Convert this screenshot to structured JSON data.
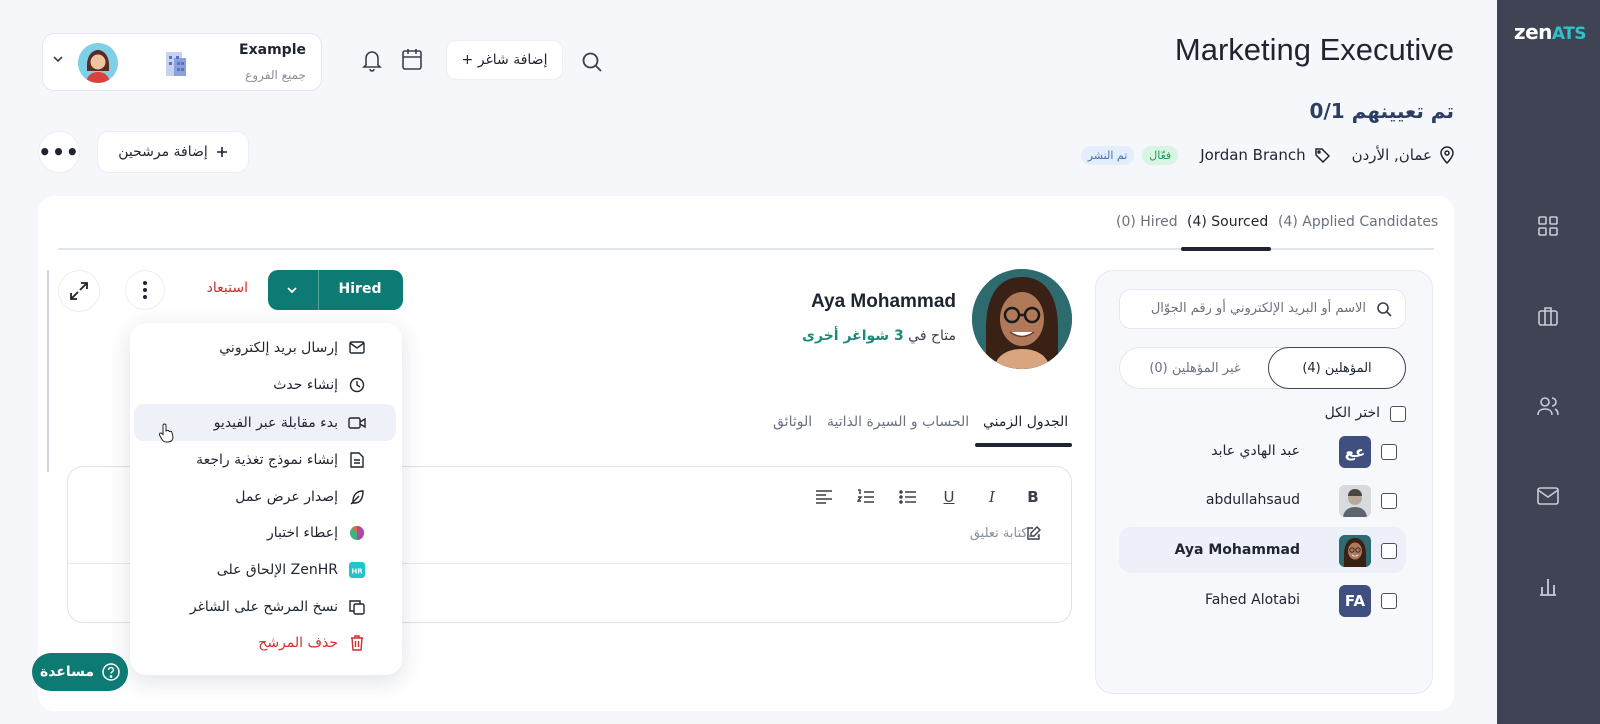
{
  "app": {
    "logo_main": "zen",
    "logo_accent": "ATS"
  },
  "sidebar": {
    "items": [
      "dashboard-icon",
      "jobs-icon",
      "candidates-icon",
      "messages-icon",
      "reports-icon"
    ]
  },
  "header": {
    "org_name": "Example",
    "org_subtitle": "جميع الفروع",
    "add_job_label": "+ إضافة شاغر"
  },
  "job": {
    "title": "Marketing Executive",
    "hired_count": "0/1 تم تعيينهم",
    "location": "عمان, الأردن",
    "branch": "Jordan Branch",
    "status_badge": "فعّال",
    "published_badge": "تم النشر"
  },
  "actions": {
    "add_candidates_label": "إضافة مرشحين"
  },
  "tabs": [
    {
      "label": "(4) Applied Candidates"
    },
    {
      "label": "(4) Sourced",
      "active": true
    },
    {
      "label": "(0) Hired"
    }
  ],
  "candidate_list": {
    "search_placeholder": "الاسم أو البريد الإلكتروني أو رقم الجوّال",
    "qualified_label": "المؤهلين (4)",
    "unqualified_label": "غير المؤهلين (0)",
    "select_all_label": "اختر الكل",
    "candidates": [
      {
        "name": "عبد الهادي عابد",
        "initials": "عع",
        "color": "#3f5080"
      },
      {
        "name": "abdullahsaud",
        "initials": "",
        "photo": true
      },
      {
        "name": "Aya Mohammad",
        "initials": "",
        "photo": true,
        "selected": true
      },
      {
        "name": "Fahed Alotabi",
        "initials": "FA",
        "color": "#3f5080"
      }
    ]
  },
  "profile": {
    "name": "Aya Mohammad",
    "subtitle_prefix": "متاح في",
    "subtitle_link": "3 شواغر أخرى",
    "stage_label": "Hired",
    "reject_label": "استبعاد",
    "tabs": [
      "الجدول الزمني",
      "الحساب و السيرة الذاتية",
      "الوثائق"
    ],
    "comment_placeholder": "كتابة تعليق...",
    "toolbar": [
      "B",
      "I",
      "U"
    ]
  },
  "menu": {
    "items": [
      {
        "label": "إرسال بريد إلكتروني",
        "icon": "mail-icon"
      },
      {
        "label": "إنشاء حدث",
        "icon": "clock-icon"
      },
      {
        "label": "بدء مقابلة عبر الفيديو",
        "icon": "video-icon"
      },
      {
        "label": "إنشاء نموذج تغذية راجعة",
        "icon": "document-icon"
      },
      {
        "label": "إصدار عرض عمل",
        "icon": "feather-icon"
      },
      {
        "label": "إعطاء اختبار",
        "icon": "brain-icon"
      },
      {
        "label": "الإلحاق على ZenHR",
        "icon": "zenhr-icon"
      },
      {
        "label": "نسخ المرشح على الشاغر",
        "icon": "copy-icon"
      },
      {
        "label": "حذف المرشح",
        "icon": "trash-icon"
      }
    ]
  },
  "help": {
    "label": "مساعدة"
  },
  "colors": {
    "primary": "#0d7b73",
    "sidebar": "#3f4354",
    "danger": "#d42d2d",
    "accent": "#2ec4c7"
  }
}
